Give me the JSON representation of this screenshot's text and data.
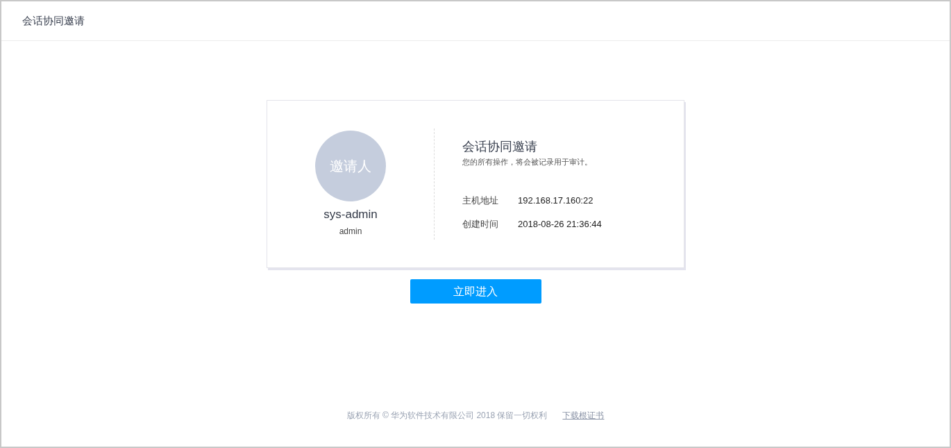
{
  "header": {
    "title": "会话协同邀请"
  },
  "inviter": {
    "avatar_label": "邀请人",
    "name": "sys-admin",
    "role": "admin"
  },
  "invitation": {
    "title": "会话协同邀请",
    "notice": "您的所有操作，将会被记录用于审计。",
    "fields": [
      {
        "label": "主机地址",
        "value": "192.168.17.160:22"
      },
      {
        "label": "创建时间",
        "value": "2018-08-26 21:36:44"
      }
    ]
  },
  "enter_button": "立即进入",
  "footer": {
    "copyright": "版权所有 © 华为软件技术有限公司 2018 保留一切权利",
    "link": "下载根证书"
  }
}
